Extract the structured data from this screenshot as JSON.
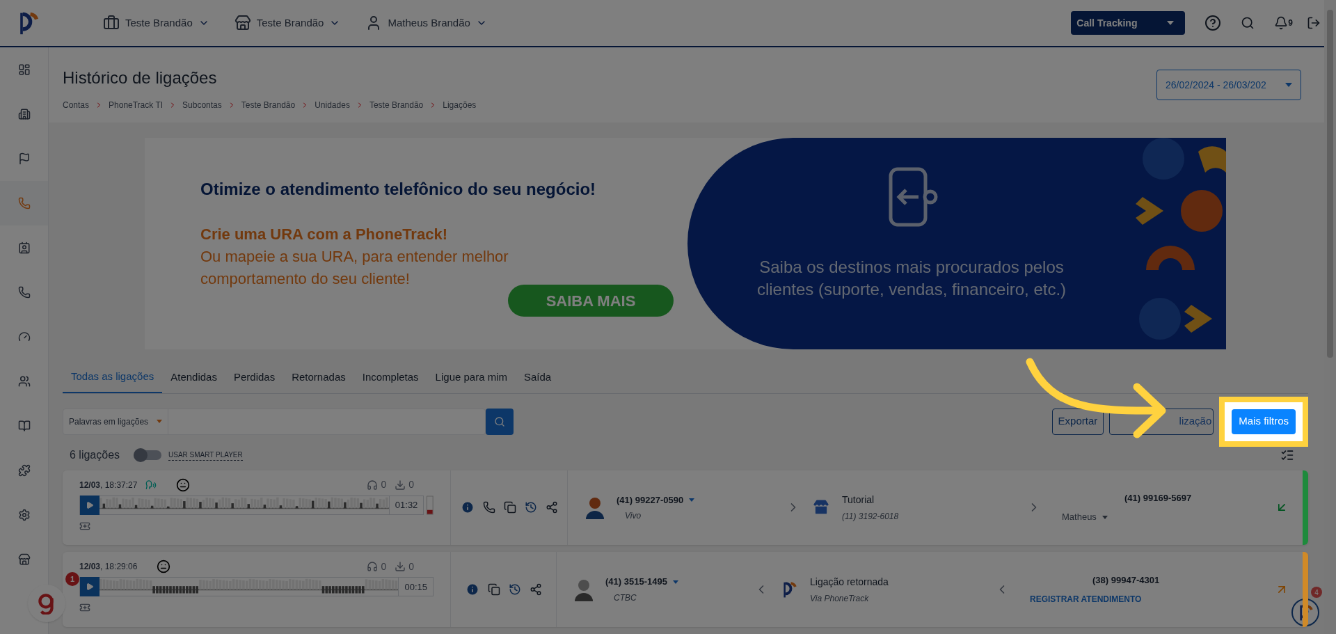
{
  "header": {
    "menus": [
      {
        "label": "Teste Brandão",
        "kind": "company"
      },
      {
        "label": "Teste Brandão",
        "kind": "store"
      },
      {
        "label": "Matheus Brandão",
        "kind": "user"
      }
    ],
    "product": "Call Tracking",
    "notifications": "9"
  },
  "sidebar": {
    "items": [
      {
        "selected": false
      },
      {
        "selected": false
      },
      {
        "selected": false
      },
      {
        "selected": true
      },
      {
        "selected": false
      },
      {
        "selected": false
      },
      {
        "selected": false
      },
      {
        "selected": false
      },
      {
        "selected": false
      },
      {
        "selected": false
      },
      {
        "selected": false
      },
      {
        "selected": false
      }
    ]
  },
  "page": {
    "title": "Histórico de ligações",
    "breadcrumb": [
      "Contas",
      "PhoneTrack TI",
      "Subcontas",
      "Teste Brandão",
      "Unidades",
      "Teste Brandão",
      "Ligações"
    ],
    "date_range": "26/02/2024 - 26/03/202"
  },
  "banner": {
    "headline": "Otimize o atendimento telefônico do seu negócio!",
    "subheadline": "Crie uma URA com a PhoneTrack!",
    "body": "Ou mapeie a sua URA, para entender melhor comportamento do seu cliente!",
    "button": "SAIBA MAIS",
    "side_text": "Saiba os destinos mais procurados pelos clientes (suporte, vendas, financeiro, etc.)"
  },
  "tabs": [
    {
      "label": "Todas as ligações",
      "selected": true
    },
    {
      "label": "Atendidas",
      "selected": false
    },
    {
      "label": "Perdidas",
      "selected": false
    },
    {
      "label": "Retornadas",
      "selected": false
    },
    {
      "label": "Incompletas",
      "selected": false
    },
    {
      "label": "Ligue para mim",
      "selected": false
    },
    {
      "label": "Saída",
      "selected": false
    }
  ],
  "search": {
    "scope": "Palavras em ligações"
  },
  "actions": {
    "export": "Exportar",
    "customize": "lização",
    "more_filters": "Mais filtros"
  },
  "count": "6 ligações",
  "smart_player": {
    "label": "USAR SMART PLAYER",
    "on": false
  },
  "calls": [
    {
      "color": "#1e8a3c",
      "datetime": "**12/03**, 18:37:27",
      "speech": true,
      "listens": "0",
      "downloads": "0",
      "duration": "01:32",
      "call_button": true,
      "caller": {
        "number": "(41) 99227-0590",
        "carrier": "Vivo",
        "identified": true
      },
      "forward": true,
      "source": {
        "name": "Tutorial",
        "detail": "(11) 3192-6018",
        "kind": "store"
      },
      "receiver": {
        "number": "(41) 99169-5697",
        "agent": "Matheus"
      },
      "incoming": true
    },
    {
      "color": "#d08a28",
      "datetime": "**12/03**, 18:29:06",
      "speech": false,
      "listens": "0",
      "downloads": "0",
      "duration": "00:15",
      "call_button": false,
      "caller": {
        "number": "(41) 3515-1495",
        "carrier": "CTBC",
        "identified": false
      },
      "forward": false,
      "source": {
        "name": "Ligação retornada",
        "detail": "Via PhoneTrack",
        "kind": "brand"
      },
      "receiver": {
        "number": "(38) 99947-4301",
        "link": "REGISTRAR ATENDIMENTO"
      },
      "incoming": false
    }
  ],
  "widgets": {
    "chat_badge": "1",
    "help_badge": "4"
  }
}
